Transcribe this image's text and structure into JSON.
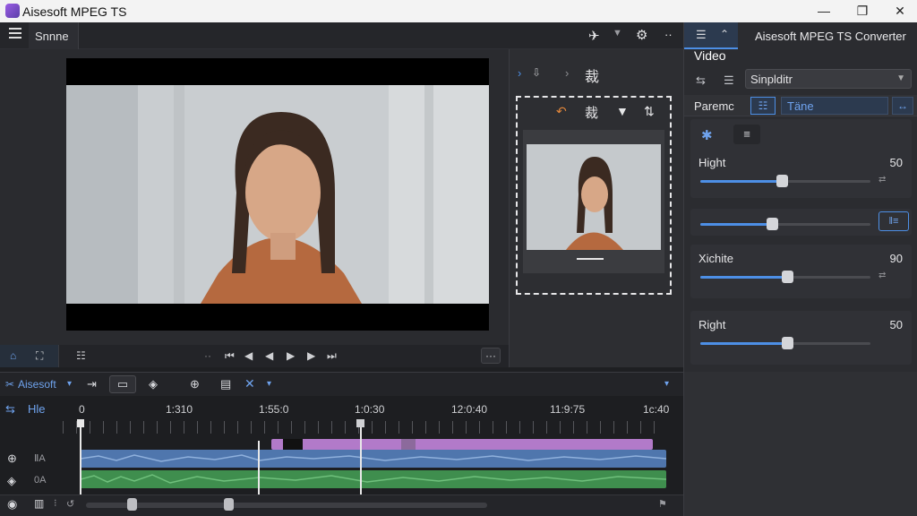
{
  "window": {
    "title": "Aisesoft MPEG TS",
    "minimize": "—",
    "maximize": "❐",
    "close": "✕"
  },
  "toolbar": {
    "menu_label": "Snnne",
    "app_title": "Aisesoft MPEG TS Converter",
    "more": "··"
  },
  "crop_panel": {
    "breadcrumb": "裁",
    "crop_tool_label": "裁"
  },
  "settings": {
    "tab_video": "Video",
    "preset_select": "Sinplditr",
    "params_label": "Paremc",
    "tone_field": "Täne",
    "slider1": {
      "label": "Hight",
      "value": "50",
      "level": 0.48
    },
    "slider2": {
      "level": 0.42,
      "btn": "‖≡"
    },
    "slider3": {
      "label": "Xichite",
      "value": "90",
      "level": 0.51
    },
    "slider4": {
      "label": "Right",
      "value": "50",
      "level": 0.51
    }
  },
  "controls": {
    "more": "···"
  },
  "timeline": {
    "toolbar_label": "Aisesoft",
    "track_label": "Hle",
    "tracks": [
      {
        "label": "ⅡA"
      },
      {
        "label": "0A"
      }
    ],
    "ticks": [
      "0",
      "1:310",
      "1:55:0",
      "1:0:30",
      "12:0:40",
      "11:9:75",
      "1c:40"
    ]
  },
  "colors": {
    "accent": "#4d8fe6",
    "video_clip": "#4f76ad",
    "audio_clip": "#3f8e4e",
    "overlay_clip": "#b27ac9"
  }
}
